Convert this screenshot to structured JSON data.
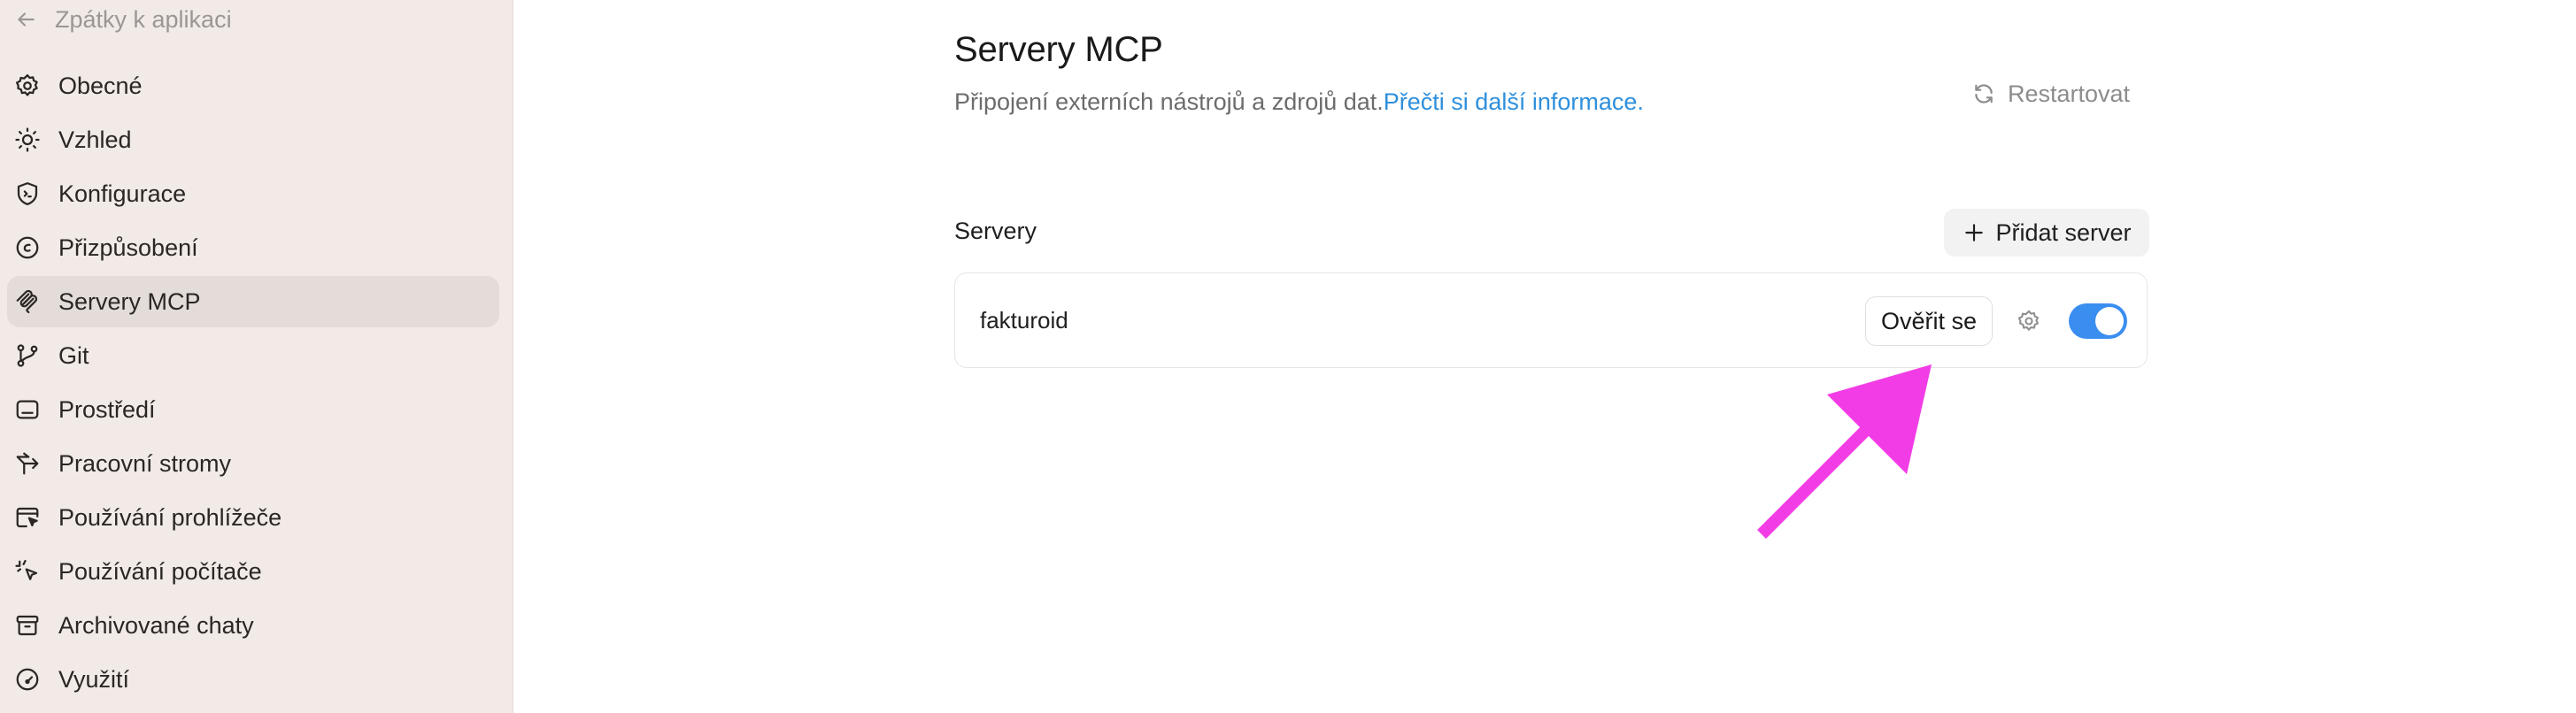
{
  "sidebar": {
    "back_label": "Zpátky k aplikaci",
    "items": [
      {
        "label": "Obecné",
        "icon": "gear-icon"
      },
      {
        "label": "Vzhled",
        "icon": "sun-icon"
      },
      {
        "label": "Konfigurace",
        "icon": "shield-code-icon"
      },
      {
        "label": "Přizpůsobení",
        "icon": "smile-circle-icon"
      },
      {
        "label": "Servery MCP",
        "icon": "mcp-icon",
        "active": true
      },
      {
        "label": "Git",
        "icon": "git-branch-icon"
      },
      {
        "label": "Prostředí",
        "icon": "terminal-window-icon"
      },
      {
        "label": "Pracovní stromy",
        "icon": "worktree-icon"
      },
      {
        "label": "Používání prohlížeče",
        "icon": "browser-cursor-icon"
      },
      {
        "label": "Používání počítače",
        "icon": "cursor-click-icon"
      },
      {
        "label": "Archivované chaty",
        "icon": "archive-icon"
      },
      {
        "label": "Využití",
        "icon": "gauge-icon"
      }
    ]
  },
  "main": {
    "title": "Servery MCP",
    "subtitle_text": "Připojení externích nástrojů a zdrojů dat.",
    "subtitle_link": "Přečti si další informace.",
    "restart_label": "Restartovat",
    "section_label": "Servery",
    "add_server_label": "Přidat server",
    "servers": [
      {
        "name": "fakturoid",
        "verify_label": "Ověřit se",
        "enabled": true
      }
    ]
  },
  "colors": {
    "sidebar_bg": "#f1eae7",
    "accent_link": "#2e8fdc",
    "toggle_on": "#3a8ef0",
    "annotation_arrow": "#f23ce6"
  }
}
